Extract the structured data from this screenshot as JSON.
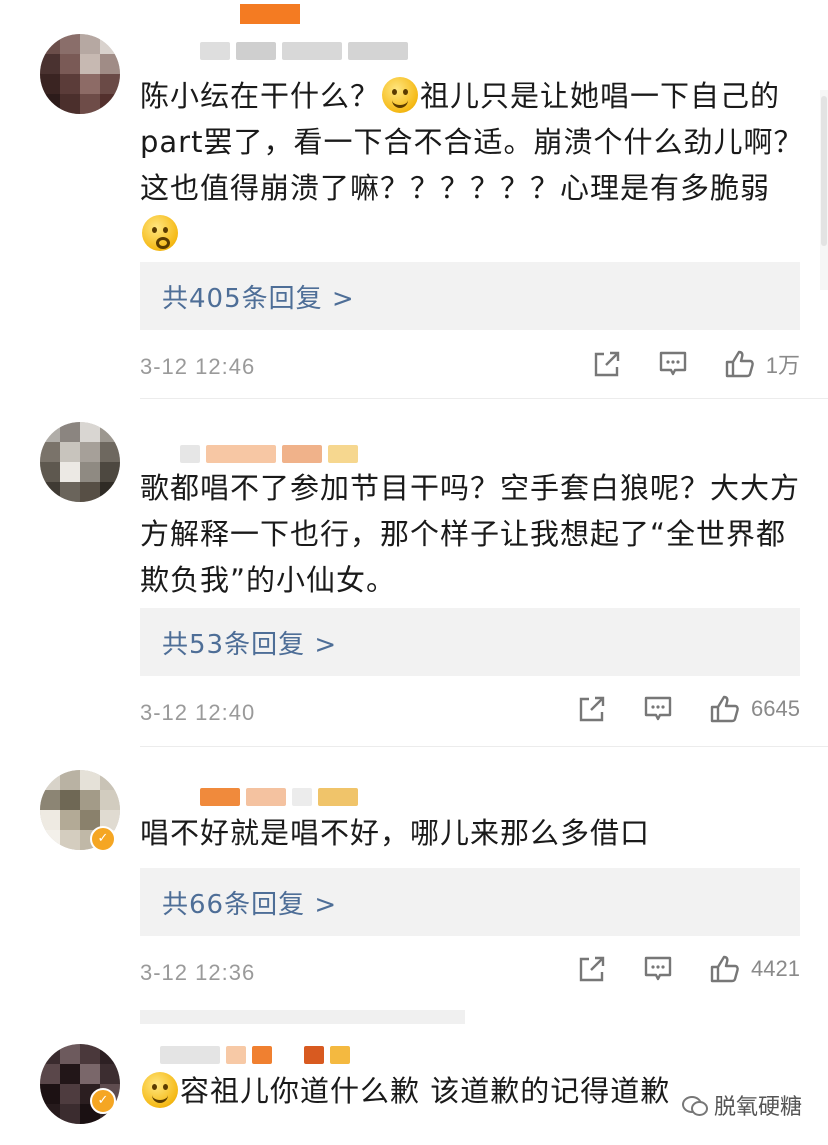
{
  "comments": [
    {
      "text_parts": [
        "陈小纭在干什么？",
        "祖儿只是让她唱一下自己的part罢了，看一下合不合适。崩溃个什么劲儿啊？这也值得崩溃了嘛？？？？？？心理是有多脆弱"
      ],
      "replies": "共405条回复 >",
      "time": "3-12 12:46",
      "likes": "1万",
      "verified": false
    },
    {
      "text": "歌都唱不了参加节目干吗？空手套白狼呢？大大方方解释一下也行，那个样子让我想起了“全世界都欺负我”的小仙女。",
      "replies": "共53条回复 >",
      "time": "3-12 12:40",
      "likes": "6645",
      "verified": false
    },
    {
      "text": "唱不好就是唱不好，哪儿来那么多借口",
      "replies": "共66条回复 >",
      "time": "3-12 12:36",
      "likes": "4421",
      "verified": true
    },
    {
      "text": "容祖儿你道什么歉 该道歉的记得道歉",
      "verified": true
    }
  ],
  "icons": {
    "share": "share-icon",
    "comment": "comment-icon",
    "like": "thumbs-up-icon",
    "verified": "verified-badge-icon",
    "emoji": "emoji-icon"
  },
  "watermark": "脱氧硬糖",
  "colors": {
    "reply_link": "#4e6e97",
    "reply_bg": "#f2f2f2",
    "verified": "#f5a623",
    "accent_orange": "#f47b22"
  }
}
